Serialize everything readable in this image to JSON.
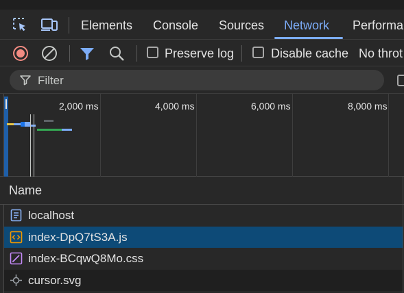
{
  "tabs": {
    "items": [
      "Elements",
      "Console",
      "Sources",
      "Network",
      "Performa"
    ],
    "active": "Network"
  },
  "toolbar": {
    "preserve_log": "Preserve log",
    "disable_cache": "Disable cache",
    "throttling": "No throt"
  },
  "filter": {
    "placeholder": "Filter"
  },
  "overview": {
    "ticks": [
      "2,000 ms",
      "4,000 ms",
      "6,000 ms",
      "8,000 ms"
    ]
  },
  "table": {
    "column_name": "Name",
    "rows": [
      {
        "name": "localhost",
        "type": "document",
        "icon": "document-icon"
      },
      {
        "name": "index-DpQ7tS3A.js",
        "type": "script",
        "icon": "script-icon",
        "selected": true
      },
      {
        "name": "index-BCqwQ8Mo.css",
        "type": "stylesheet",
        "icon": "stylesheet-icon"
      },
      {
        "name": "cursor.svg",
        "type": "image",
        "icon": "svg-image-icon"
      }
    ]
  },
  "colors": {
    "accent": "#7cacf8",
    "record_red": "#f28b82",
    "selected_row": "#0d4a77"
  }
}
